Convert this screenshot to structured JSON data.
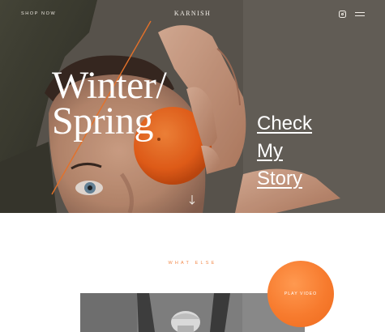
{
  "nav": {
    "shop_label": "SHOP NOW",
    "brand": "KARNISH",
    "instagram_icon": "instagram-icon",
    "menu_icon": "hamburger-menu-icon"
  },
  "hero": {
    "headline_line1": "Winter/",
    "headline_line2": "Spring",
    "story_line1": "Check",
    "story_line2": "My",
    "story_line3": "Story",
    "scroll_icon": "down-arrow-icon",
    "accent_color": "#f77b2e"
  },
  "section": {
    "eyebrow": "WHAT ELSE",
    "play_label": "PLAY VIDEO",
    "eyebrow_color": "#f2894a"
  }
}
